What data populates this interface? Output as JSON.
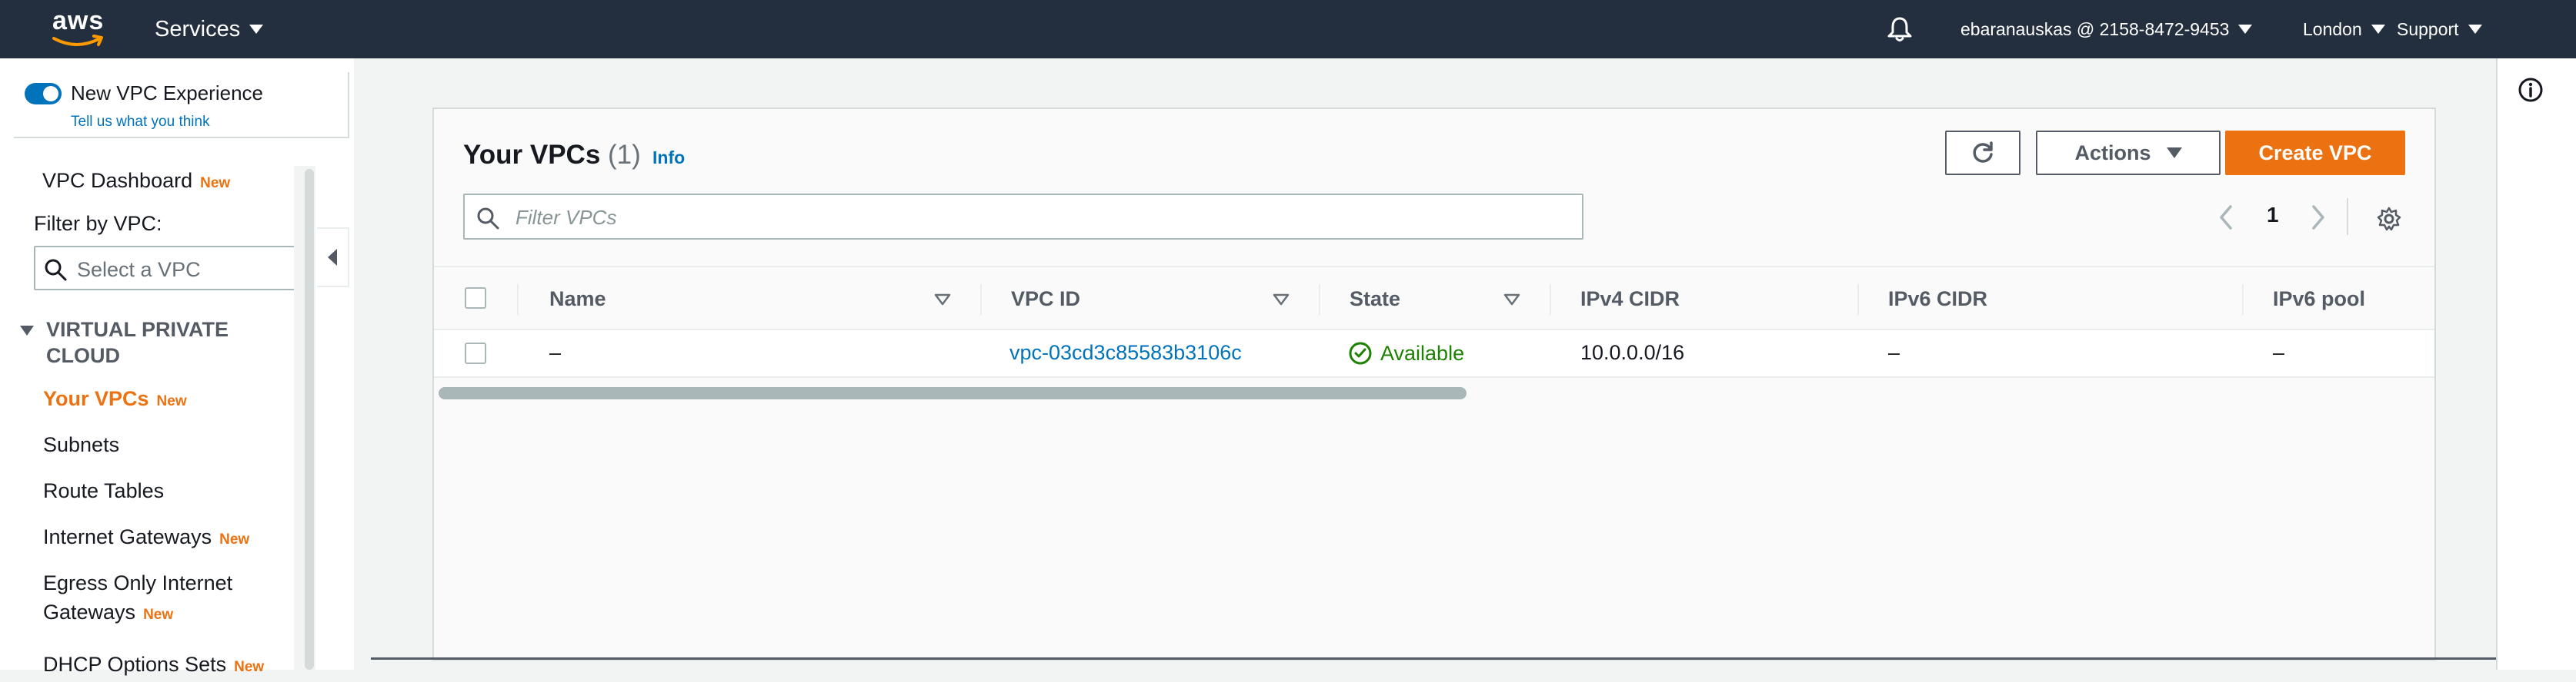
{
  "topnav": {
    "logo_text": "aws",
    "services_label": "Services",
    "account_label": "ebaranauskas @ 2158-8472-9453",
    "region_label": "London",
    "support_label": "Support",
    "icons": [
      "bell-icon",
      "caret-down-icon"
    ]
  },
  "sidebar": {
    "toggle_label": "New VPC Experience",
    "toggle_on": true,
    "feedback_link": "Tell us what you think",
    "dashboard": {
      "label": "VPC Dashboard",
      "badge": "New"
    },
    "filter_label": "Filter by VPC:",
    "filter_placeholder": "Select a VPC",
    "section_title": "VIRTUAL PRIVATE CLOUD",
    "items": [
      {
        "label": "Your VPCs",
        "badge": "New",
        "active": true
      },
      {
        "label": "Subnets",
        "badge": ""
      },
      {
        "label": "Route Tables",
        "badge": ""
      },
      {
        "label": "Internet Gateways",
        "badge": "New"
      },
      {
        "label": "Egress Only Internet",
        "label2": "Gateways",
        "badge": "New"
      },
      {
        "label": "DHCP Options Sets",
        "badge": "New"
      }
    ]
  },
  "panel": {
    "title": "Your VPCs",
    "count": "(1)",
    "info_link": "Info",
    "actions_label": "Actions",
    "create_label": "Create VPC",
    "filter_placeholder": "Filter VPCs",
    "page_number": "1"
  },
  "table": {
    "columns": [
      "Name",
      "VPC ID",
      "State",
      "IPv4 CIDR",
      "IPv6 CIDR",
      "IPv6 pool"
    ],
    "rows": [
      {
        "name": "–",
        "vpc_id": "vpc-03cd3c85583b3106c",
        "state": "Available",
        "ipv4_cidr": "10.0.0.0/16",
        "ipv6_cidr": "–",
        "ipv6_pool": "–"
      }
    ]
  },
  "colors": {
    "nav_bg": "#232f3e",
    "accent_orange": "#ec7211",
    "link_blue": "#0073bb",
    "success_green": "#1d8102"
  }
}
